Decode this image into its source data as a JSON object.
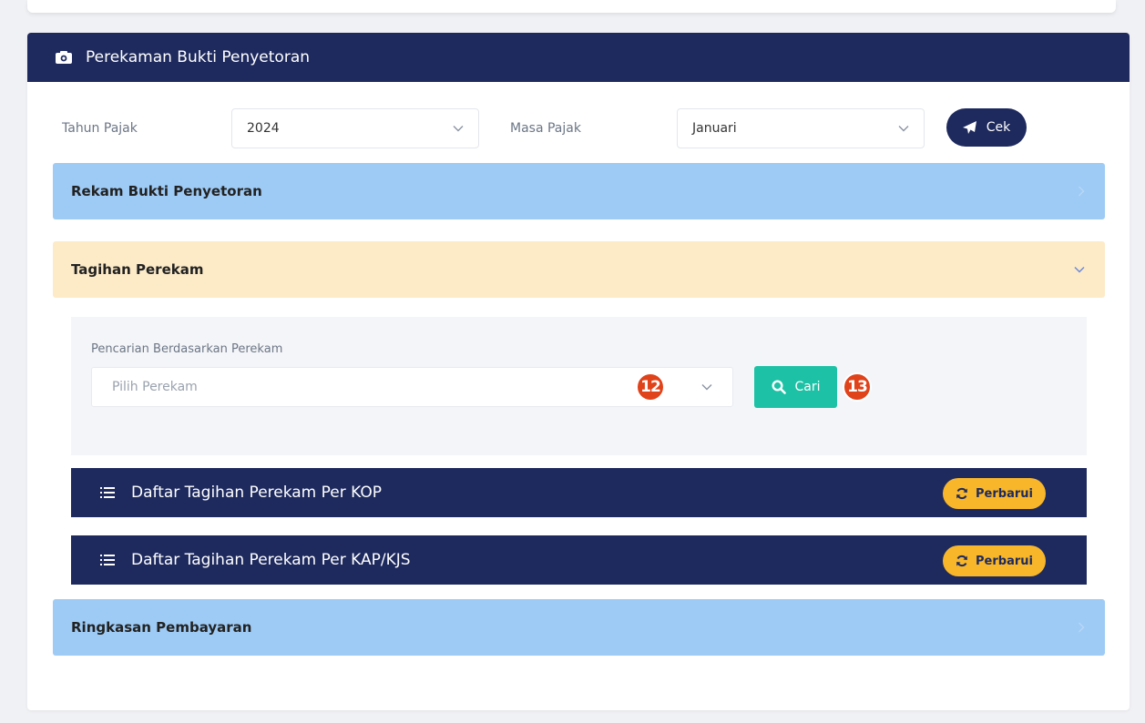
{
  "header": {
    "title": "Perekaman Bukti Penyetoran"
  },
  "filters": {
    "tahun_label": "Tahun Pajak",
    "tahun_value": "2024",
    "masa_label": "Masa Pajak",
    "masa_value": "Januari",
    "cek_label": "Cek"
  },
  "sections": {
    "rekam": "Rekam Bukti Penyetoran",
    "tagihan": "Tagihan Perekam",
    "ringkasan": "Ringkasan Pembayaran"
  },
  "search": {
    "label": "Pencarian Berdasarkan Perekam",
    "placeholder": "Pilih Perekam",
    "button_label": "Cari"
  },
  "lists": [
    {
      "title": "Daftar Tagihan Perekam Per KOP",
      "button_label": "Perbarui"
    },
    {
      "title": "Daftar Tagihan Perekam Per KAP/KJS",
      "button_label": "Perbarui"
    }
  ],
  "markers": [
    "12",
    "13"
  ],
  "colors": {
    "navy": "#1e2a5e",
    "accordion_blue": "#9ecbf5",
    "accordion_yellow": "#fdebc8",
    "teal": "#1dc2a6",
    "amber": "#f8b62a",
    "marker_red": "#e0421a"
  },
  "icons": {
    "header": "camera-icon",
    "cek": "paper-plane-icon",
    "cari": "search-icon",
    "perbarui": "refresh-icon",
    "list": "list-icon",
    "select": "chevron-down-icon",
    "collapsed": "chevron-right-icon"
  }
}
